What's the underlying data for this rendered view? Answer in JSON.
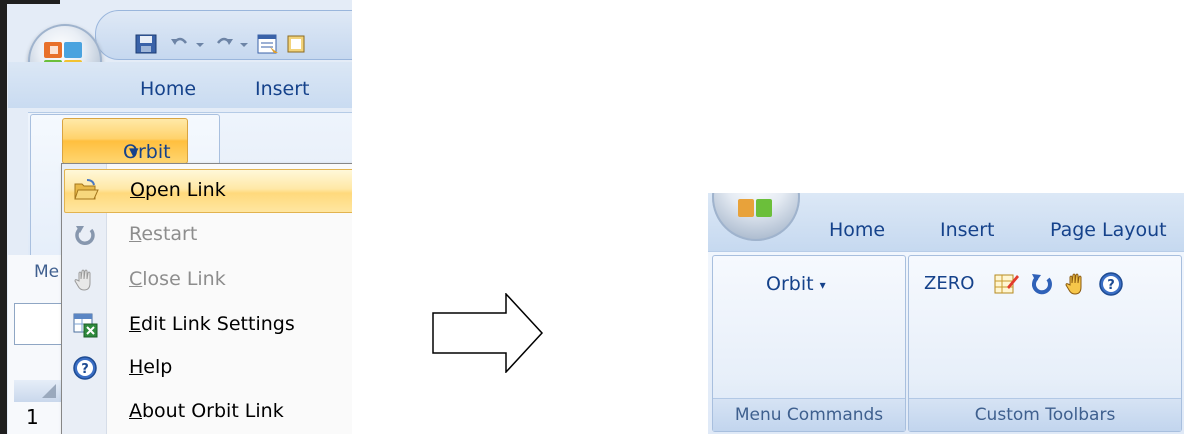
{
  "left": {
    "tabs": [
      "Home",
      "Insert"
    ],
    "orbit_button": "Orbit",
    "partial_group_label": "Me",
    "row_number": "1",
    "menu": [
      {
        "label": "Open Link",
        "mnemonic": "O",
        "rest": "pen Link",
        "enabled": true,
        "highlighted": true,
        "icon": "folder-open-icon"
      },
      {
        "label": "Restart",
        "mnemonic": "R",
        "rest": "estart",
        "enabled": false,
        "highlighted": false,
        "icon": "restart-icon"
      },
      {
        "label": "Close Link",
        "mnemonic": "C",
        "rest": "lose Link",
        "enabled": false,
        "highlighted": false,
        "icon": "hand-icon"
      },
      {
        "label": "Edit Link Settings",
        "mnemonic": "E",
        "rest": "dit Link Settings",
        "enabled": true,
        "highlighted": false,
        "icon": "excel-settings-icon"
      },
      {
        "label": "Help",
        "mnemonic": "H",
        "rest": "elp",
        "enabled": true,
        "highlighted": false,
        "icon": "help-icon"
      },
      {
        "label": "About Orbit Link",
        "mnemonic": "A",
        "rest": "bout Orbit Link",
        "enabled": true,
        "highlighted": false,
        "icon": ""
      }
    ]
  },
  "right": {
    "tabs": [
      "Home",
      "Insert",
      "Page Layout"
    ],
    "orbit_button": "Orbit",
    "zero_label": "ZERO",
    "groups": [
      "Menu Commands",
      "Custom Toolbars"
    ]
  },
  "colors": {
    "ribbon_text": "#15428b",
    "highlight": "#ffd97c",
    "disabled_text": "#8d8d8d"
  }
}
